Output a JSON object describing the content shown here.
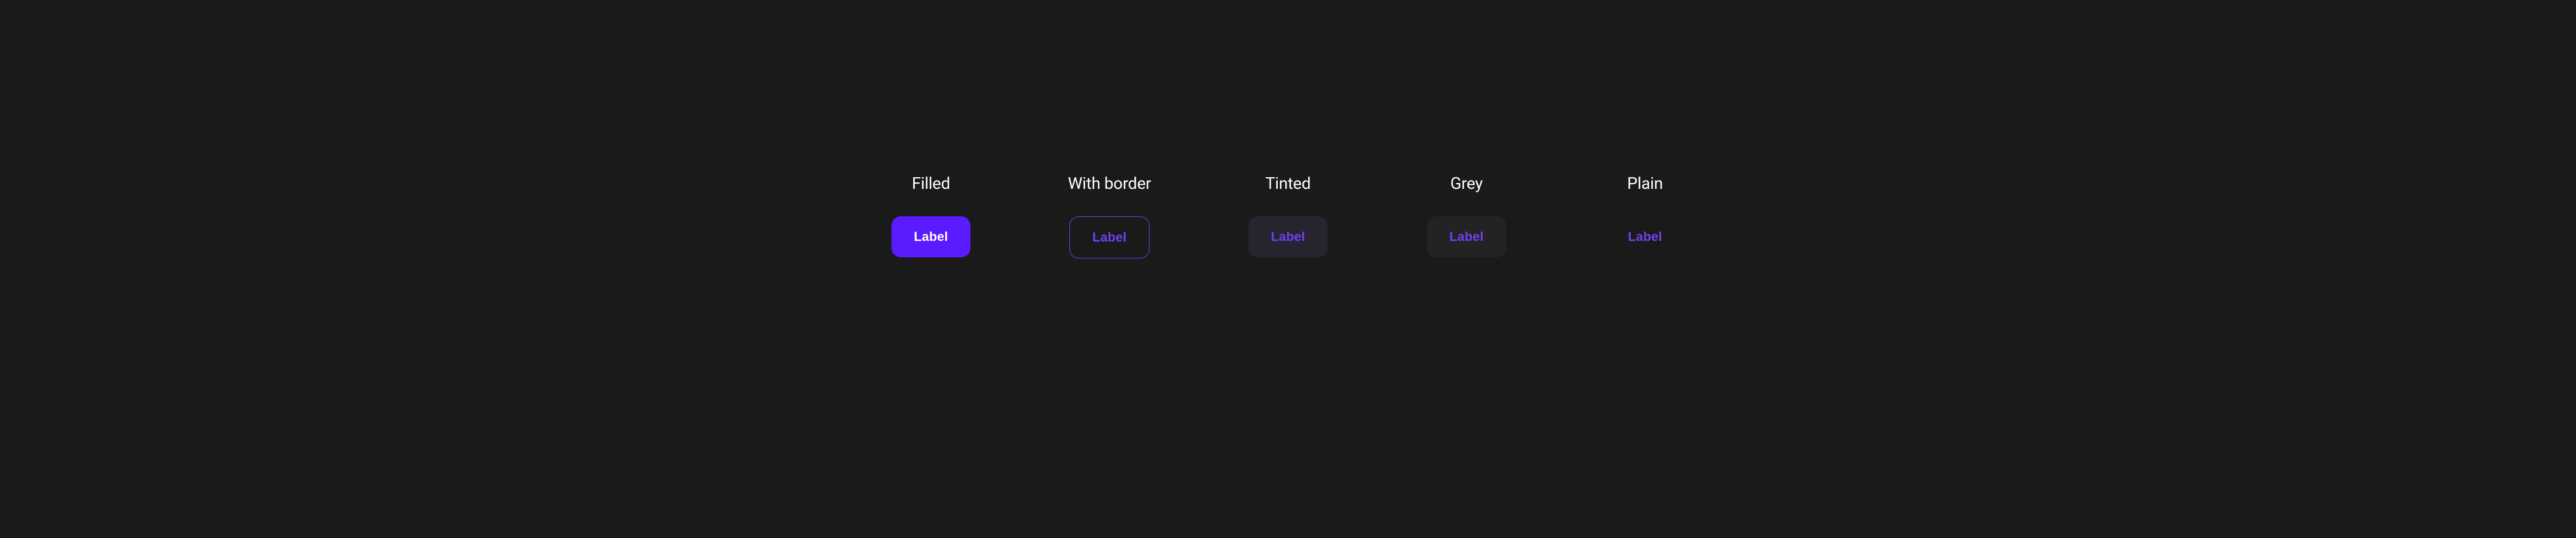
{
  "variants": [
    {
      "title": "Filled",
      "label": "Label"
    },
    {
      "title": "With border",
      "label": "Label"
    },
    {
      "title": "Tinted",
      "label": "Label"
    },
    {
      "title": "Grey",
      "label": "Label"
    },
    {
      "title": "Plain",
      "label": "Label"
    }
  ],
  "colors": {
    "background": "#1a1a1a",
    "accent": "#5a1bff",
    "accent_text": "#7040f0",
    "tinted_bg": "#26242e",
    "grey_bg": "#232323",
    "text": "#ffffff"
  }
}
